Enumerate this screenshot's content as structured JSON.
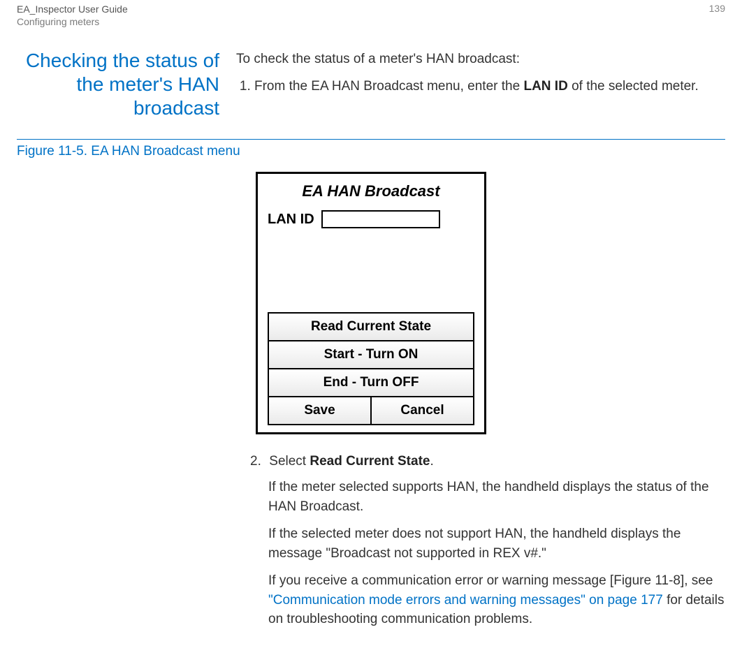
{
  "header": {
    "title": "EA_Inspector User Guide",
    "subtitle": "Configuring meters",
    "page_number": "139"
  },
  "section": {
    "heading": "Checking the status of the meter's HAN broadcast",
    "intro": "To check the status of a meter's HAN broadcast:",
    "step1_pre": "From the EA HAN Broadcast menu, enter the ",
    "step1_bold": "LAN ID",
    "step1_post": " of the selected meter."
  },
  "figure": {
    "caption": "Figure 11-5. EA HAN Broadcast menu",
    "device_title": "EA HAN Broadcast",
    "lan_label": "LAN ID",
    "lan_value": "",
    "btn_read": "Read Current State",
    "btn_on": "Start - Turn ON",
    "btn_off": "End - Turn OFF",
    "btn_save": "Save",
    "btn_cancel": "Cancel"
  },
  "after": {
    "step2_num": "2.",
    "step2_pre": "Select ",
    "step2_bold": "Read Current State",
    "step2_post": ".",
    "para1": "If the meter selected supports HAN, the handheld displays the status of the HAN Broadcast.",
    "para2": "If the selected meter does not support HAN, the handheld displays the message \"Broadcast not supported in REX v#.\"",
    "para3_pre": "If you receive a communication error or warning message [Figure 11-8], see ",
    "para3_link": "\"Communication mode errors and warning messages\" on page 177",
    "para3_post": " for details on troubleshooting communication problems."
  }
}
